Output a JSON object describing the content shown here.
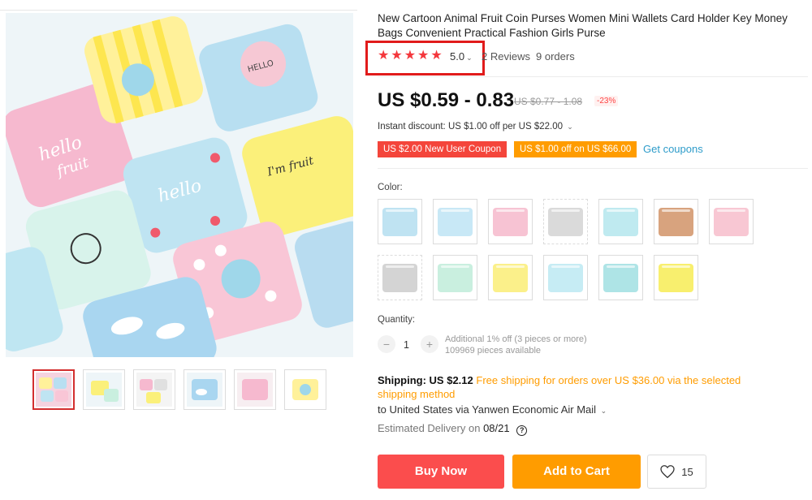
{
  "product": {
    "title": "New Cartoon Animal Fruit Coin Purses Women Mini Wallets Card Holder Key Money Bags Convenient Practical Fashion Girls Purse"
  },
  "rating": {
    "stars": 5,
    "score": "5.0",
    "reviews": "2 Reviews",
    "orders": "9 orders"
  },
  "pricing": {
    "price": "US $0.59 - 0.83",
    "original": "US $0.77 - 1.08",
    "discount": "-23%"
  },
  "promotions": {
    "instant_discount": "Instant discount: US $1.00 off per US $22.00",
    "coupon_new_user": "US $2.00 New User Coupon",
    "coupon_off": "US $1.00 off on US $66.00",
    "get_coupons": "Get coupons"
  },
  "color": {
    "label": "Color:",
    "options": [
      {
        "color": "#bfe3f2",
        "dashed": false
      },
      {
        "color": "#c8e8f6",
        "dashed": false
      },
      {
        "color": "#f7c3d3",
        "dashed": false
      },
      {
        "color": "#dadada",
        "dashed": true
      },
      {
        "color": "#bfeaf0",
        "dashed": false
      },
      {
        "color": "#d8a37e",
        "dashed": false
      },
      {
        "color": "#f8c7d3",
        "dashed": false
      },
      {
        "color": "#d4d4d4",
        "dashed": true
      },
      {
        "color": "#c9efdf",
        "dashed": false
      },
      {
        "color": "#fbf08a",
        "dashed": false
      },
      {
        "color": "#c6ecf4",
        "dashed": false
      },
      {
        "color": "#aee4e6",
        "dashed": false
      },
      {
        "color": "#f8ef6e",
        "dashed": false
      }
    ]
  },
  "quantity": {
    "label": "Quantity:",
    "value": "1",
    "extra": "Additional 1% off (3 pieces or more)",
    "available": "109969 pieces available"
  },
  "shipping": {
    "label": "Shipping: US $2.12",
    "free_note": "Free shipping for orders over US $36.00 via the selected shipping method",
    "destination": "to United States via Yanwen Economic Air Mail",
    "delivery_prefix": "Estimated Delivery on",
    "delivery_date": "08/21"
  },
  "actions": {
    "buy_now": "Buy Now",
    "add_to_cart": "Add to Cart",
    "wishlist_count": "15"
  },
  "colors": {
    "star": "#f4373c",
    "buy": "#fb4d4d",
    "cart": "#ff9c00",
    "link": "#2e9cca",
    "highlight_box": "#e11b1b"
  },
  "icons": [
    "star-icon",
    "chevron-down-icon",
    "minus-icon",
    "plus-icon",
    "help-icon",
    "heart-icon"
  ]
}
